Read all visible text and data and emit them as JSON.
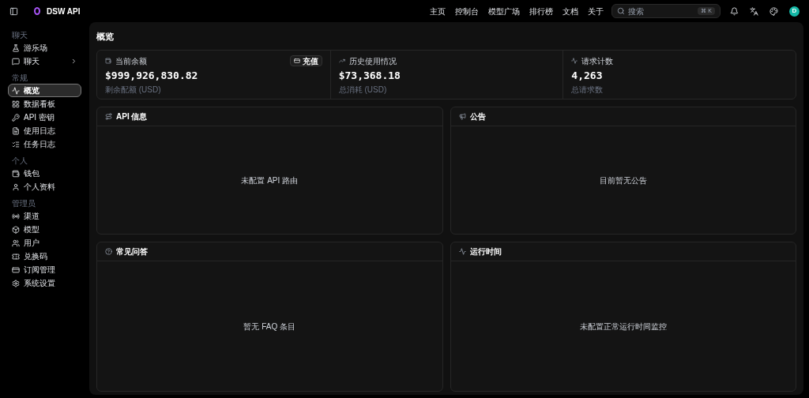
{
  "header": {
    "brand": "DSW API",
    "nav": [
      "主页",
      "控制台",
      "模型广场",
      "排行榜",
      "文档",
      "关于"
    ],
    "search": {
      "placeholder": "搜索",
      "shortcut": "⌘ K"
    },
    "avatar": "D"
  },
  "sidebar": {
    "sections": [
      {
        "title": "聊天",
        "items": [
          {
            "label": "游乐场",
            "selected": false
          },
          {
            "label": "聊天",
            "selected": false,
            "expandable": true
          }
        ]
      },
      {
        "title": "常规",
        "items": [
          {
            "label": "概览",
            "selected": true
          },
          {
            "label": "数据看板",
            "selected": false
          },
          {
            "label": "API 密钥",
            "selected": false
          },
          {
            "label": "使用日志",
            "selected": false
          },
          {
            "label": "任务日志",
            "selected": false
          }
        ]
      },
      {
        "title": "个人",
        "items": [
          {
            "label": "钱包",
            "selected": false
          },
          {
            "label": "个人资料",
            "selected": false
          }
        ]
      },
      {
        "title": "管理员",
        "items": [
          {
            "label": "渠道",
            "selected": false
          },
          {
            "label": "模型",
            "selected": false
          },
          {
            "label": "用户",
            "selected": false
          },
          {
            "label": "兑换码",
            "selected": false
          },
          {
            "label": "订阅管理",
            "selected": false
          },
          {
            "label": "系统设置",
            "selected": false
          }
        ]
      }
    ]
  },
  "page_title": "概览",
  "stats": [
    {
      "label": "当前余额",
      "value": "$999,926,830.82",
      "sub": "剩余配额 (USD)",
      "action": "充值"
    },
    {
      "label": "历史使用情况",
      "value": "$73,368.18",
      "sub": "总消耗 (USD)"
    },
    {
      "label": "请求计数",
      "value": "4,263",
      "sub": "总请求数"
    }
  ],
  "panels": [
    {
      "title": "API 信息",
      "empty": "未配置 API 路由"
    },
    {
      "title": "公告",
      "empty": "目前暂无公告"
    },
    {
      "title": "常见问答",
      "empty": "暂无 FAQ 条目"
    },
    {
      "title": "运行时间",
      "empty": "未配置正常运行时间监控"
    }
  ]
}
